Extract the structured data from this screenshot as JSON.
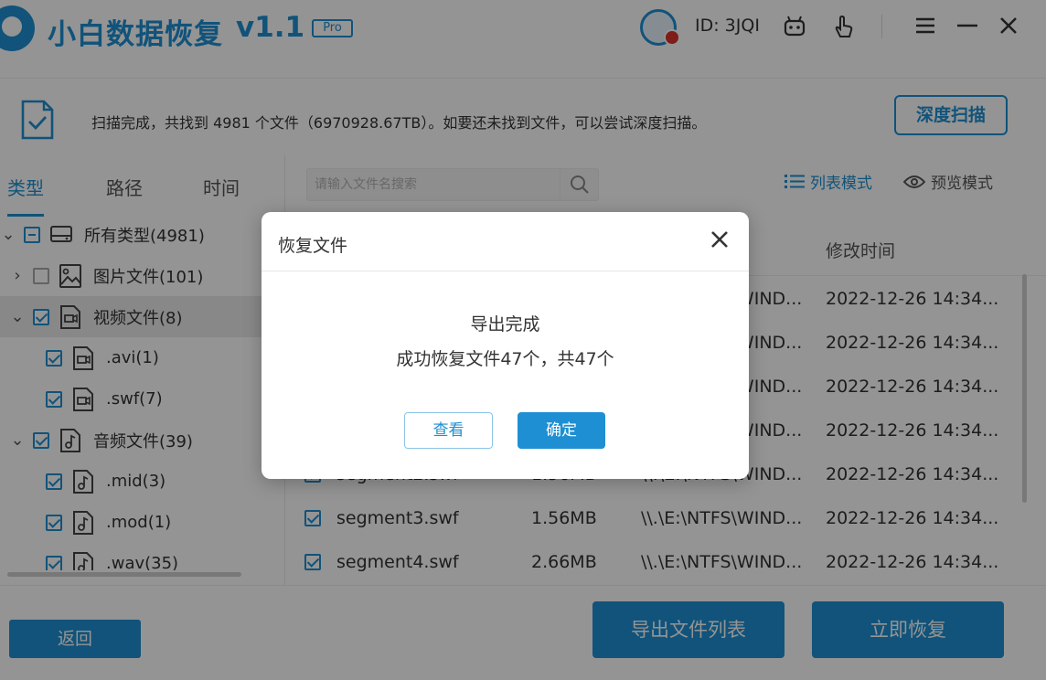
{
  "app": {
    "title": "小白数据恢复",
    "version": "v1.1",
    "badge": "Pro",
    "user_id": "ID: 3JQI",
    "accent": "#1e8fd2"
  },
  "titlebar": {
    "icons": [
      "avatar-icon",
      "robot-icon",
      "hand-pointer-icon"
    ],
    "menu": "☰",
    "minimize": "—",
    "close": "✕"
  },
  "status": {
    "text": "扫描完成，共找到 4981 个文件（6970928.67TB）。如要还未找到文件，可以尝试深度扫描。",
    "deep_scan_label": "深度扫描"
  },
  "tabs": [
    {
      "label": "类型",
      "active": true
    },
    {
      "label": "路径",
      "active": false
    },
    {
      "label": "时间",
      "active": false
    }
  ],
  "tree": [
    {
      "chev": "⌄",
      "check": "partial",
      "icon": "drive-icon",
      "label": "所有类型(4981)",
      "indent": 0
    },
    {
      "chev": "›",
      "check": "none",
      "icon": "image-file-icon",
      "label": "图片文件(101)",
      "indent": 1
    },
    {
      "chev": "⌄",
      "check": "checked",
      "icon": "video-file-icon",
      "label": "视频文件(8)",
      "indent": 1,
      "selected": true
    },
    {
      "chev": "",
      "check": "checked",
      "icon": "video-file-icon",
      "label": ".avi(1)",
      "indent": 2
    },
    {
      "chev": "",
      "check": "checked",
      "icon": "video-file-icon",
      "label": ".swf(7)",
      "indent": 2
    },
    {
      "chev": "⌄",
      "check": "checked",
      "icon": "audio-file-icon",
      "label": "音频文件(39)",
      "indent": 1
    },
    {
      "chev": "",
      "check": "checked",
      "icon": "audio-file-icon",
      "label": ".mid(3)",
      "indent": 2
    },
    {
      "chev": "",
      "check": "checked",
      "icon": "audio-file-icon",
      "label": ".mod(1)",
      "indent": 2
    },
    {
      "chev": "",
      "check": "checked",
      "icon": "audio-file-icon",
      "label": ".wav(35)",
      "indent": 2
    }
  ],
  "search": {
    "placeholder": "请输入文件名搜索"
  },
  "view_modes": {
    "list_label": "列表模式",
    "preview_label": "预览模式"
  },
  "columns": {
    "mtime": "修改时间"
  },
  "files": [
    {
      "name": "",
      "size": "",
      "path": "\\\\.\\E:\\NTFS\\WIND...",
      "time": "2022-12-26 14:34..."
    },
    {
      "name": "",
      "size": "",
      "path": "\\\\.\\E:\\NTFS\\WIND...",
      "time": "2022-12-26 14:34..."
    },
    {
      "name": "",
      "size": "",
      "path": "\\\\.\\E:\\NTFS\\WIND...",
      "time": "2022-12-26 14:34..."
    },
    {
      "name": "",
      "size": "",
      "path": "\\\\.\\E:\\NTFS\\WIND...",
      "time": "2022-12-26 14:34..."
    },
    {
      "name": "segment2.swf",
      "size": "1.56MB",
      "path": "\\\\.\\E:\\NTFS\\WIND...",
      "time": "2022-12-26 14:34..."
    },
    {
      "name": "segment3.swf",
      "size": "1.56MB",
      "path": "\\\\.\\E:\\NTFS\\WIND...",
      "time": "2022-12-26 14:34..."
    },
    {
      "name": "segment4.swf",
      "size": "2.66MB",
      "path": "\\\\.\\E:\\NTFS\\WIND...",
      "time": "2022-12-26 14:34..."
    }
  ],
  "bottom": {
    "back_label": "返回",
    "export_label": "导出文件列表",
    "recover_label": "立即恢复"
  },
  "dialog": {
    "title": "恢复文件",
    "message1": "导出完成",
    "message2": "成功恢复文件47个，共47个",
    "view_label": "查看",
    "ok_label": "确定"
  }
}
